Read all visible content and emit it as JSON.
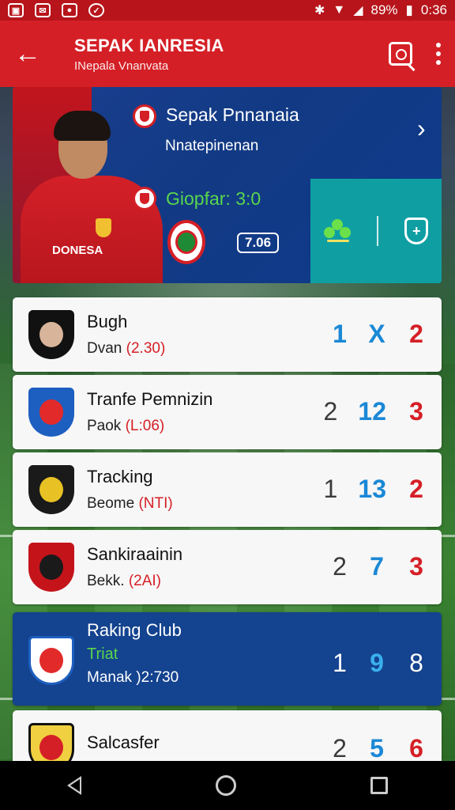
{
  "status_bar": {
    "battery": "89%",
    "time": "0:36"
  },
  "app_bar": {
    "title": "SEPAK IANRESIA",
    "subtitle": "INepala Vnanvata",
    "back_icon": "arrow-left-icon",
    "search_icon": "search-icon",
    "more_icon": "more-vertical-icon"
  },
  "hero": {
    "title": "Sepak Pnnanaia",
    "subtitle": "Nnatepinenan",
    "score": "Giopfar: 3:0",
    "time": "7.06",
    "jersey_text": "DONESA",
    "accent": "#d51f26",
    "panel_color": "#0f9fa3"
  },
  "matches": [
    {
      "name": "Bugh",
      "sub": "Dvan",
      "sub_red": "(2.30)",
      "odds": [
        "1",
        "X",
        "2"
      ],
      "logo_bg": "#111111",
      "logo_inner": "#d8b49a"
    },
    {
      "name": "Tranfe Pemnizin",
      "sub": "Paok",
      "sub_red": "(L:06)",
      "odds": [
        "2",
        "12",
        "3"
      ],
      "logo_bg": "#1d5fc0",
      "logo_inner": "#e22a2a"
    },
    {
      "name": "Tracking",
      "sub": "Beome",
      "sub_red": "(NTI)",
      "odds": [
        "1",
        "13",
        "2"
      ],
      "logo_bg": "#1a1a1a",
      "logo_inner": "#e8c224"
    },
    {
      "name": "Sankiraainin",
      "sub": "Bekk.",
      "sub_red": "(2AI)",
      "odds": [
        "2",
        "7",
        "3"
      ],
      "logo_bg": "#c4141a",
      "logo_inner": "#1a1a1a"
    }
  ],
  "featured": {
    "name": "Raking Club",
    "tag": "Triat",
    "sub": "Manak )2:730",
    "odds": [
      "1",
      "9",
      "8"
    ]
  },
  "last_match": {
    "name": "Salcasfer",
    "odds": [
      "2",
      "5",
      "6"
    ]
  }
}
